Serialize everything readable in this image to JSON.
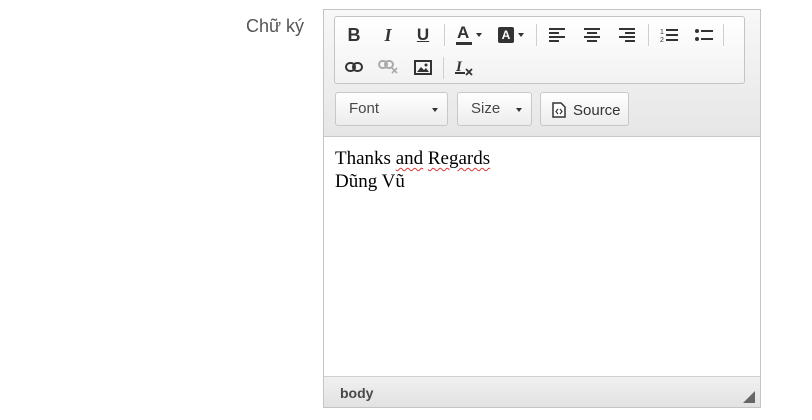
{
  "field": {
    "label": "Chữ ký"
  },
  "toolbar": {
    "bold": "B",
    "italic": "I",
    "underline": "U",
    "text_color": "A",
    "bg_color": "A",
    "font_label": "Font",
    "size_label": "Size",
    "source_label": "Source"
  },
  "content": {
    "line1_a": "Thanks ",
    "line1_b": "and",
    "line1_c": " ",
    "line1_d": "Regards",
    "line2": "Dũng Vũ"
  },
  "statusbar": {
    "path": "body"
  },
  "colors": {
    "accent_underline": "#d83838",
    "text_color_bar": "#333333"
  }
}
